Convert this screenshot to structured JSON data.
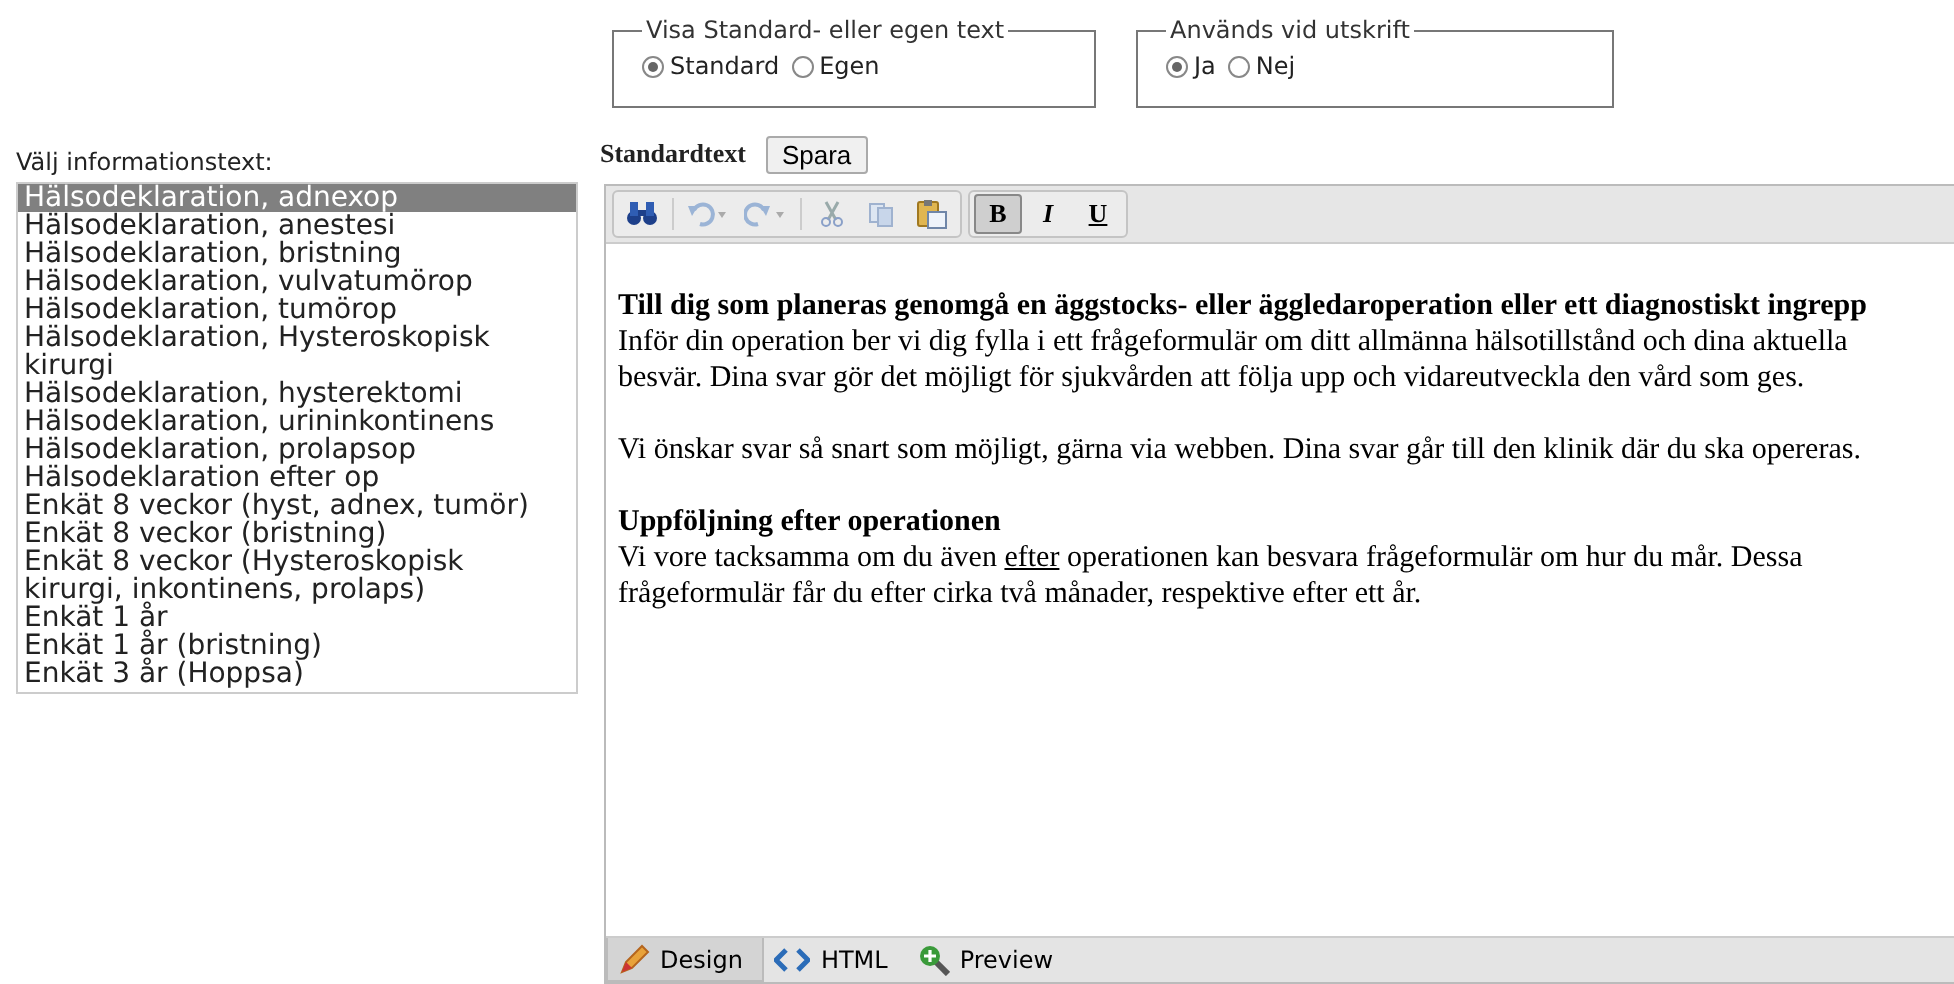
{
  "display_mode": {
    "legend": "Visa Standard- eller egen text",
    "options": [
      {
        "label": "Standard",
        "selected": true
      },
      {
        "label": "Egen",
        "selected": false
      }
    ]
  },
  "print_usage": {
    "legend": "Används vid utskrift",
    "options": [
      {
        "label": "Ja",
        "selected": true
      },
      {
        "label": "Nej",
        "selected": false
      }
    ]
  },
  "info_list": {
    "label": "Välj informationstext:",
    "items": [
      {
        "label": "Hälsodeklaration, adnexop",
        "selected": true
      },
      {
        "label": "Hälsodeklaration, anestesi",
        "selected": false
      },
      {
        "label": "Hälsodeklaration, bristning",
        "selected": false
      },
      {
        "label": "Hälsodeklaration, vulvatumörop",
        "selected": false
      },
      {
        "label": "Hälsodeklaration, tumörop",
        "selected": false
      },
      {
        "label": "Hälsodeklaration, Hysteroskopisk kirurgi",
        "selected": false
      },
      {
        "label": "Hälsodeklaration, hysterektomi",
        "selected": false
      },
      {
        "label": "Hälsodeklaration, urininkontinens",
        "selected": false
      },
      {
        "label": "Hälsodeklaration, prolapsop",
        "selected": false
      },
      {
        "label": "Hälsodeklaration efter op",
        "selected": false
      },
      {
        "label": "Enkät 8 veckor (hyst, adnex, tumör)",
        "selected": false
      },
      {
        "label": "Enkät 8 veckor (bristning)",
        "selected": false
      },
      {
        "label": "Enkät 8 veckor (Hysteroskopisk kirurgi, inkontinens, prolaps)",
        "selected": false
      },
      {
        "label": "Enkät 1 år",
        "selected": false
      },
      {
        "label": "Enkät 1 år (bristning)",
        "selected": false
      },
      {
        "label": "Enkät 3 år (Hoppsa)",
        "selected": false
      }
    ]
  },
  "editor": {
    "heading": "Standardtext",
    "save_button": "Spara",
    "toolbar": [
      {
        "buttons": [
          {
            "kind": "find",
            "on": false
          },
          {
            "kind": "sep"
          },
          {
            "kind": "undo",
            "on": false
          },
          {
            "kind": "redo",
            "on": false
          },
          {
            "kind": "sep"
          },
          {
            "kind": "cut",
            "on": false
          },
          {
            "kind": "copy",
            "on": false
          },
          {
            "kind": "paste",
            "on": false
          }
        ]
      },
      {
        "buttons": [
          {
            "kind": "bold",
            "label": "B",
            "on": true
          },
          {
            "kind": "italic",
            "label": "I",
            "on": false
          },
          {
            "kind": "underline",
            "label": "U",
            "on": false
          }
        ]
      }
    ],
    "content": [
      {
        "heading": "Till dig som planeras genomgå en äggstocks- eller äggledaroperation eller ett diagnostiskt ingrepp",
        "parts": [
          {
            "text": "Inför din operation ber vi dig fylla i ett frågeformulär om ditt allmänna hälsotillstånd och dina aktuella besvär. Dina svar gör det möjligt för sjukvården att följa upp och vidareutveckla den vård som ges.",
            "underline": false
          }
        ]
      },
      {
        "parts": [
          {
            "text": "Vi önskar svar så snart som möjligt, gärna via webben. Dina svar går till den klinik där du ska opereras.",
            "underline": false
          }
        ]
      },
      {
        "heading": "Uppföljning efter operationen",
        "parts": [
          {
            "text": "Vi vore tacksamma om du även ",
            "underline": false
          },
          {
            "text": "efter",
            "underline": true
          },
          {
            "text": " operationen kan besvara frågeformulär om hur du mår. Dessa frågeformulär får du efter cirka två månader, respektive efter ett år.",
            "underline": false
          }
        ]
      }
    ],
    "modes": [
      {
        "kind": "design",
        "label": "Design",
        "selected": true
      },
      {
        "kind": "html",
        "label": "HTML",
        "selected": false
      },
      {
        "kind": "preview",
        "label": "Preview",
        "selected": false
      }
    ]
  }
}
